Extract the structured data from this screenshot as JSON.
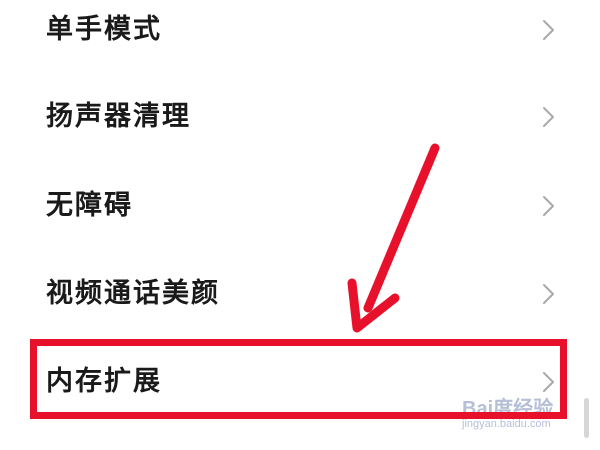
{
  "settings": {
    "items": [
      {
        "label": "单手模式",
        "icon": "chevron-right-icon"
      },
      {
        "label": "扬声器清理",
        "icon": "chevron-right-icon"
      },
      {
        "label": "无障碍",
        "icon": "chevron-right-icon"
      },
      {
        "label": "视频通话美颜",
        "icon": "chevron-right-icon"
      },
      {
        "label": "内存扩展",
        "icon": "chevron-right-icon"
      }
    ]
  },
  "annotation": {
    "color": "#e8112b",
    "highlighted_item": "内存扩展"
  },
  "watermark": {
    "main": "Bai度经验",
    "sub": "jingyan.baidu.com"
  }
}
